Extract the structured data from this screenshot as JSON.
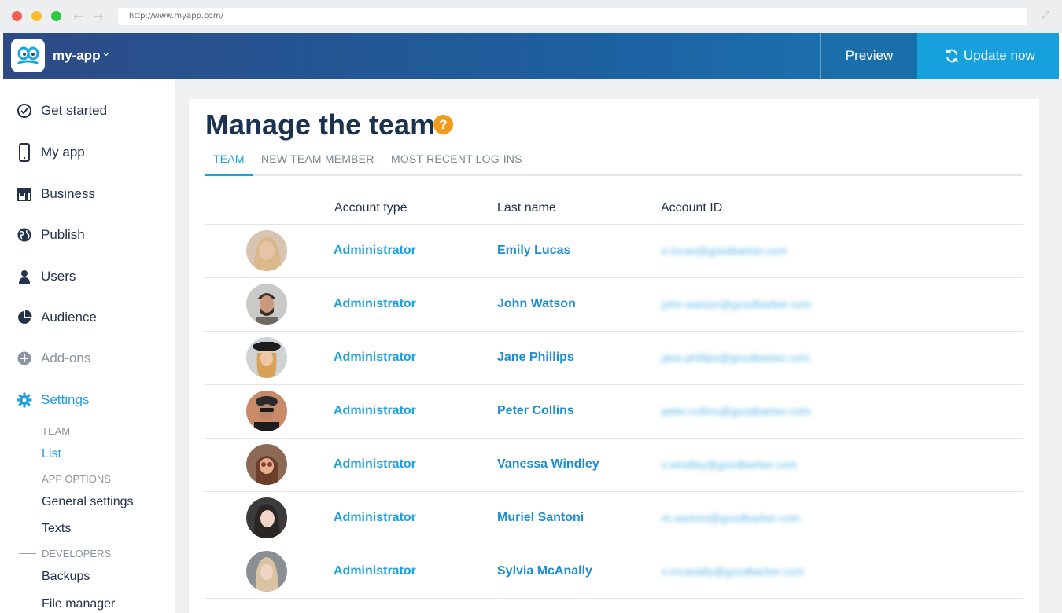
{
  "browser": {
    "url": "http://www.myapp.com/"
  },
  "header": {
    "app_name": "my-app",
    "preview_label": "Preview",
    "update_label": "Update now"
  },
  "sidebar": {
    "items": [
      {
        "label": "Get started",
        "icon": "check-circle-icon"
      },
      {
        "label": "My app",
        "icon": "phone-icon"
      },
      {
        "label": "Business",
        "icon": "store-icon"
      },
      {
        "label": "Publish",
        "icon": "globe-icon"
      },
      {
        "label": "Users",
        "icon": "user-icon"
      },
      {
        "label": "Audience",
        "icon": "pie-chart-icon"
      },
      {
        "label": "Add-ons",
        "icon": "plus-circle-icon"
      },
      {
        "label": "Settings",
        "icon": "gear-icon"
      }
    ],
    "sections": [
      {
        "title": "TEAM",
        "links": [
          "List"
        ]
      },
      {
        "title": "APP OPTIONS",
        "links": [
          "General settings",
          "Texts"
        ]
      },
      {
        "title": "DEVELOPERS",
        "links": [
          "Backups",
          "File manager"
        ]
      }
    ]
  },
  "main": {
    "title": "Manage the team",
    "help_symbol": "?",
    "tabs": [
      "TEAM",
      "NEW TEAM MEMBER",
      "MOST RECENT LOG-INS"
    ],
    "columns": [
      "Account type",
      "Last name",
      "Account ID"
    ],
    "rows": [
      {
        "type": "Administrator",
        "name": "Emily Lucas",
        "id": "e.lucas@goodbarber.com"
      },
      {
        "type": "Administrator",
        "name": "John Watson",
        "id": "john.watson@goodbarber.com"
      },
      {
        "type": "Administrator",
        "name": "Jane Phillips",
        "id": "jane.phillips@goodbarber.com"
      },
      {
        "type": "Administrator",
        "name": "Peter Collins",
        "id": "peter.collins@goodbarber.com"
      },
      {
        "type": "Administrator",
        "name": "Vanessa Windley",
        "id": "v.windley@goodbarber.com"
      },
      {
        "type": "Administrator",
        "name": "Muriel Santoni",
        "id": "m.santoni@goodbarber.com"
      },
      {
        "type": "Administrator",
        "name": "Sylvia McAnally",
        "id": "s.mcanally@goodbarber.com"
      }
    ]
  },
  "colors": {
    "accent": "#1da0dc",
    "header_start": "#2d4a86",
    "header_end": "#1a7fc0",
    "update_button": "#16a0dc",
    "help": "#f49a1a",
    "dark_text": "#24324a"
  }
}
